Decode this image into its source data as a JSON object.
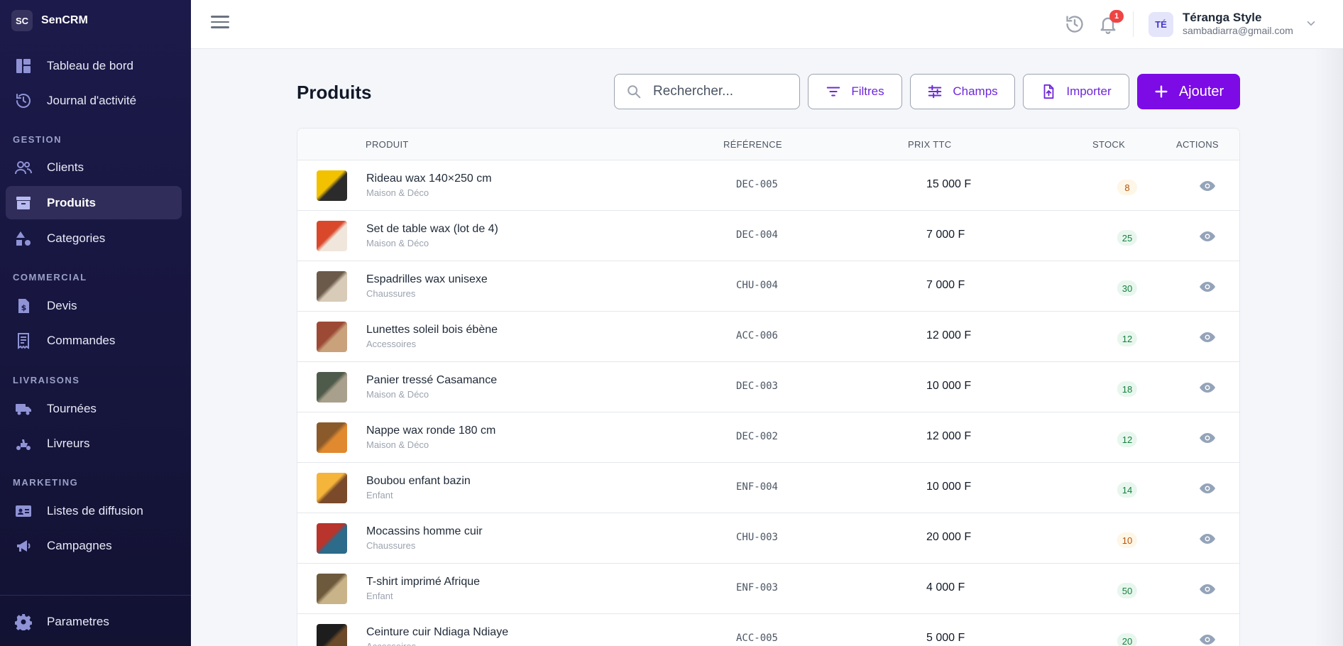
{
  "brand": {
    "badge": "SC",
    "name": "SenCRM"
  },
  "sidebar": {
    "items": [
      {
        "label": "Tableau de bord",
        "icon": "dashboard-icon"
      },
      {
        "label": "Journal d'activité",
        "icon": "history-icon"
      }
    ],
    "sections": [
      {
        "label": "GESTION",
        "items": [
          {
            "label": "Clients",
            "icon": "users-icon"
          },
          {
            "label": "Produits",
            "icon": "archive-box-icon",
            "active": true
          },
          {
            "label": "Categories",
            "icon": "shapes-icon"
          }
        ]
      },
      {
        "label": "COMMERCIAL",
        "items": [
          {
            "label": "Devis",
            "icon": "document-dollar-icon"
          },
          {
            "label": "Commandes",
            "icon": "receipt-icon"
          }
        ]
      },
      {
        "label": "LIVRAISONS",
        "items": [
          {
            "label": "Tournées",
            "icon": "truck-icon"
          },
          {
            "label": "Livreurs",
            "icon": "scooter-icon"
          }
        ]
      },
      {
        "label": "MARKETING",
        "items": [
          {
            "label": "Listes de diffusion",
            "icon": "contact-card-icon"
          },
          {
            "label": "Campagnes",
            "icon": "megaphone-icon"
          }
        ]
      }
    ],
    "footer": {
      "label": "Parametres",
      "icon": "gear-icon"
    }
  },
  "topbar": {
    "notifications_count": "1",
    "user": {
      "initials": "TÉ",
      "name": "Téranga Style",
      "email": "sambadiarra@gmail.com"
    }
  },
  "page": {
    "title": "Produits",
    "search_placeholder": "Rechercher...",
    "filters_label": "Filtres",
    "fields_label": "Champs",
    "import_label": "Importer",
    "add_label": "Ajouter"
  },
  "table": {
    "columns": [
      "PRODUIT",
      "RÉFÉRENCE",
      "PRIX TTC",
      "STOCK",
      "ACTIONS"
    ],
    "rows": [
      {
        "name": "Rideau wax 140×250 cm",
        "category": "Maison & Déco",
        "ref": "DEC-005",
        "price": "15 000 F",
        "stock": "8",
        "stock_level": "low",
        "thumb": [
          "#f2c200",
          "#2b2b2b"
        ]
      },
      {
        "name": "Set de table wax (lot de 4)",
        "category": "Maison & Déco",
        "ref": "DEC-004",
        "price": "7 000 F",
        "stock": "25",
        "stock_level": "ok",
        "thumb": [
          "#d9482b",
          "#f0e6dc"
        ]
      },
      {
        "name": "Espadrilles wax unisexe",
        "category": "Chaussures",
        "ref": "CHU-004",
        "price": "7 000 F",
        "stock": "30",
        "stock_level": "ok",
        "thumb": [
          "#6b5a4a",
          "#d8cbb8"
        ]
      },
      {
        "name": "Lunettes soleil bois ébène",
        "category": "Accessoires",
        "ref": "ACC-006",
        "price": "12 000 F",
        "stock": "12",
        "stock_level": "ok",
        "thumb": [
          "#9c4a36",
          "#c9a27c"
        ]
      },
      {
        "name": "Panier tressé Casamance",
        "category": "Maison & Déco",
        "ref": "DEC-003",
        "price": "10 000 F",
        "stock": "18",
        "stock_level": "ok",
        "thumb": [
          "#4f5b4a",
          "#a8a08c"
        ]
      },
      {
        "name": "Nappe wax ronde 180 cm",
        "category": "Maison & Déco",
        "ref": "DEC-002",
        "price": "12 000 F",
        "stock": "12",
        "stock_level": "ok",
        "thumb": [
          "#8a5a2b",
          "#e0892e"
        ]
      },
      {
        "name": "Boubou enfant bazin",
        "category": "Enfant",
        "ref": "ENF-004",
        "price": "10 000 F",
        "stock": "14",
        "stock_level": "ok",
        "thumb": [
          "#f5b43a",
          "#7a4a2a"
        ]
      },
      {
        "name": "Mocassins homme cuir",
        "category": "Chaussures",
        "ref": "CHU-003",
        "price": "20 000 F",
        "stock": "10",
        "stock_level": "low",
        "thumb": [
          "#b8342c",
          "#2c6b8a"
        ]
      },
      {
        "name": "T-shirt imprimé Afrique",
        "category": "Enfant",
        "ref": "ENF-003",
        "price": "4 000 F",
        "stock": "50",
        "stock_level": "ok",
        "thumb": [
          "#6d5a3c",
          "#c9b48a"
        ]
      },
      {
        "name": "Ceinture cuir Ndiaga Ndiaye",
        "category": "Accessoires",
        "ref": "ACC-005",
        "price": "5 000 F",
        "stock": "20",
        "stock_level": "ok",
        "thumb": [
          "#1d1d1d",
          "#6b4a2a"
        ]
      }
    ]
  }
}
